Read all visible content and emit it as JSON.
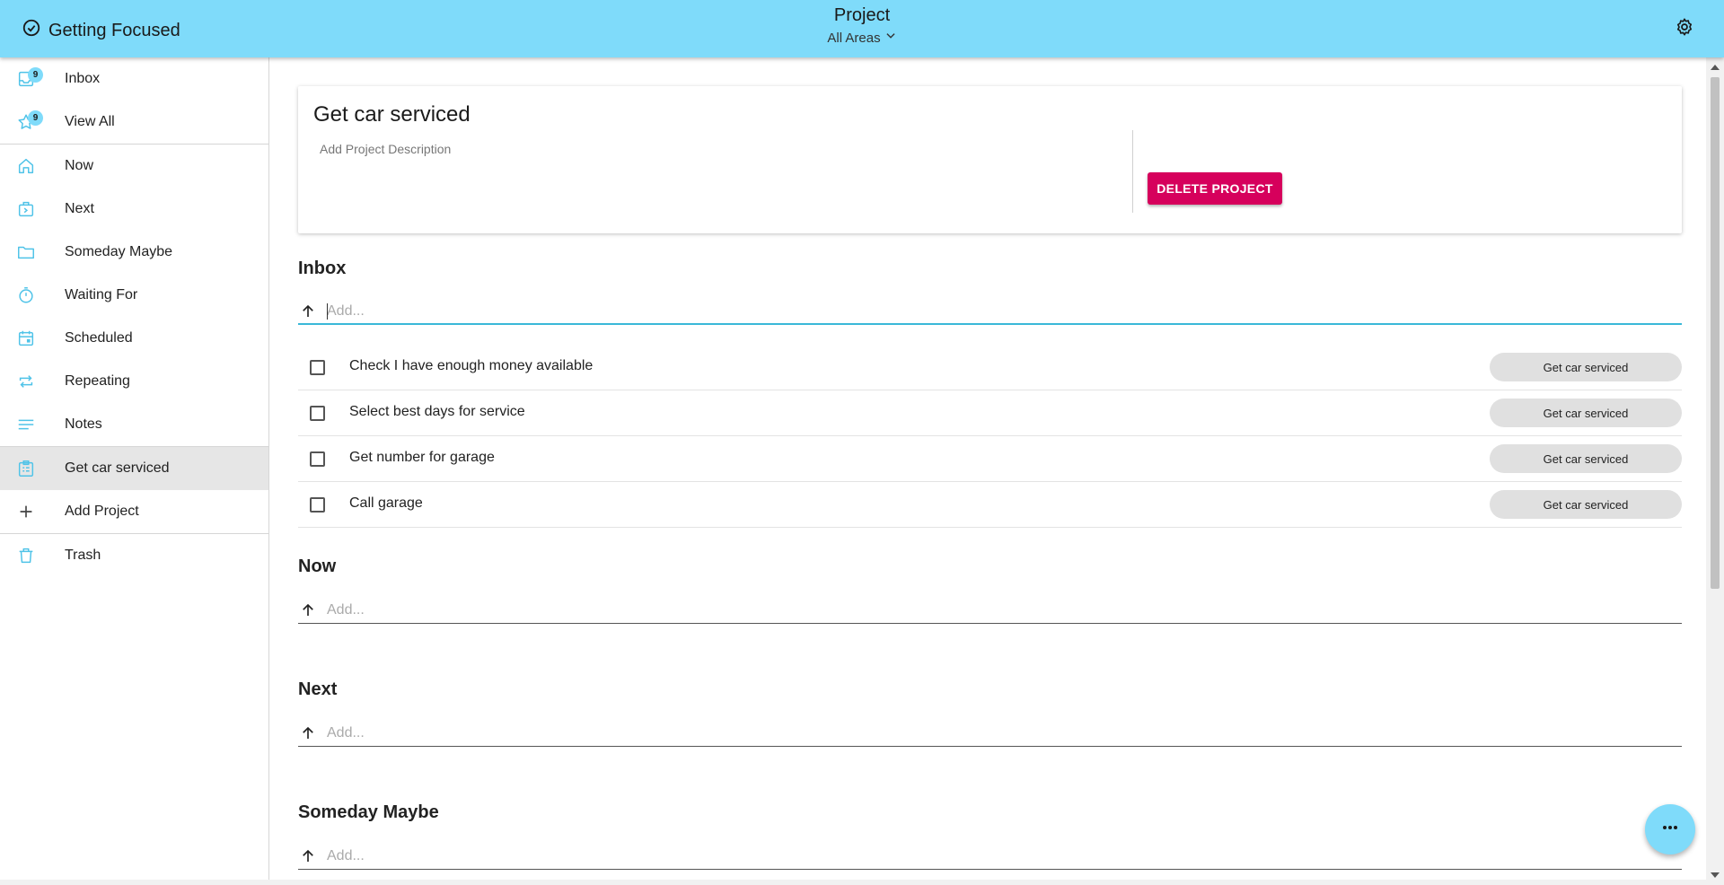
{
  "header": {
    "app_name": "Getting Focused",
    "page_title": "Project",
    "area_filter": "All Areas"
  },
  "sidebar": {
    "items": [
      {
        "label": "Inbox",
        "badge": "9",
        "icon": "inbox-icon"
      },
      {
        "label": "View All",
        "badge": "9",
        "icon": "star-icon"
      },
      {
        "label": "Now",
        "icon": "home-icon"
      },
      {
        "label": "Next",
        "icon": "next-box-icon"
      },
      {
        "label": "Someday Maybe",
        "icon": "folder-icon"
      },
      {
        "label": "Waiting For",
        "icon": "timer-icon"
      },
      {
        "label": "Scheduled",
        "icon": "calendar-icon"
      },
      {
        "label": "Repeating",
        "icon": "repeat-icon"
      },
      {
        "label": "Notes",
        "icon": "notes-icon"
      },
      {
        "label": "Get car serviced",
        "icon": "project-icon",
        "active": true
      },
      {
        "label": "Add Project",
        "icon": "plus-icon"
      },
      {
        "label": "Trash",
        "icon": "trash-icon"
      }
    ]
  },
  "project": {
    "name": "Get car serviced",
    "description_placeholder": "Add Project Description",
    "delete_label": "DELETE PROJECT"
  },
  "sections": {
    "inbox": {
      "title": "Inbox",
      "add_placeholder": "Add...",
      "tasks": [
        {
          "text": "Check I have enough money available",
          "project": "Get car serviced"
        },
        {
          "text": "Select best days for service",
          "project": "Get car serviced"
        },
        {
          "text": "Get number for garage",
          "project": "Get car serviced"
        },
        {
          "text": "Call garage",
          "project": "Get car serviced"
        }
      ]
    },
    "now": {
      "title": "Now",
      "add_placeholder": "Add..."
    },
    "next": {
      "title": "Next",
      "add_placeholder": "Add..."
    },
    "someday": {
      "title": "Someday Maybe",
      "add_placeholder": "Add..."
    }
  },
  "colors": {
    "appbar": "#7fdbfa",
    "accent_icon": "#4fc3e8",
    "delete": "#d6005c"
  }
}
